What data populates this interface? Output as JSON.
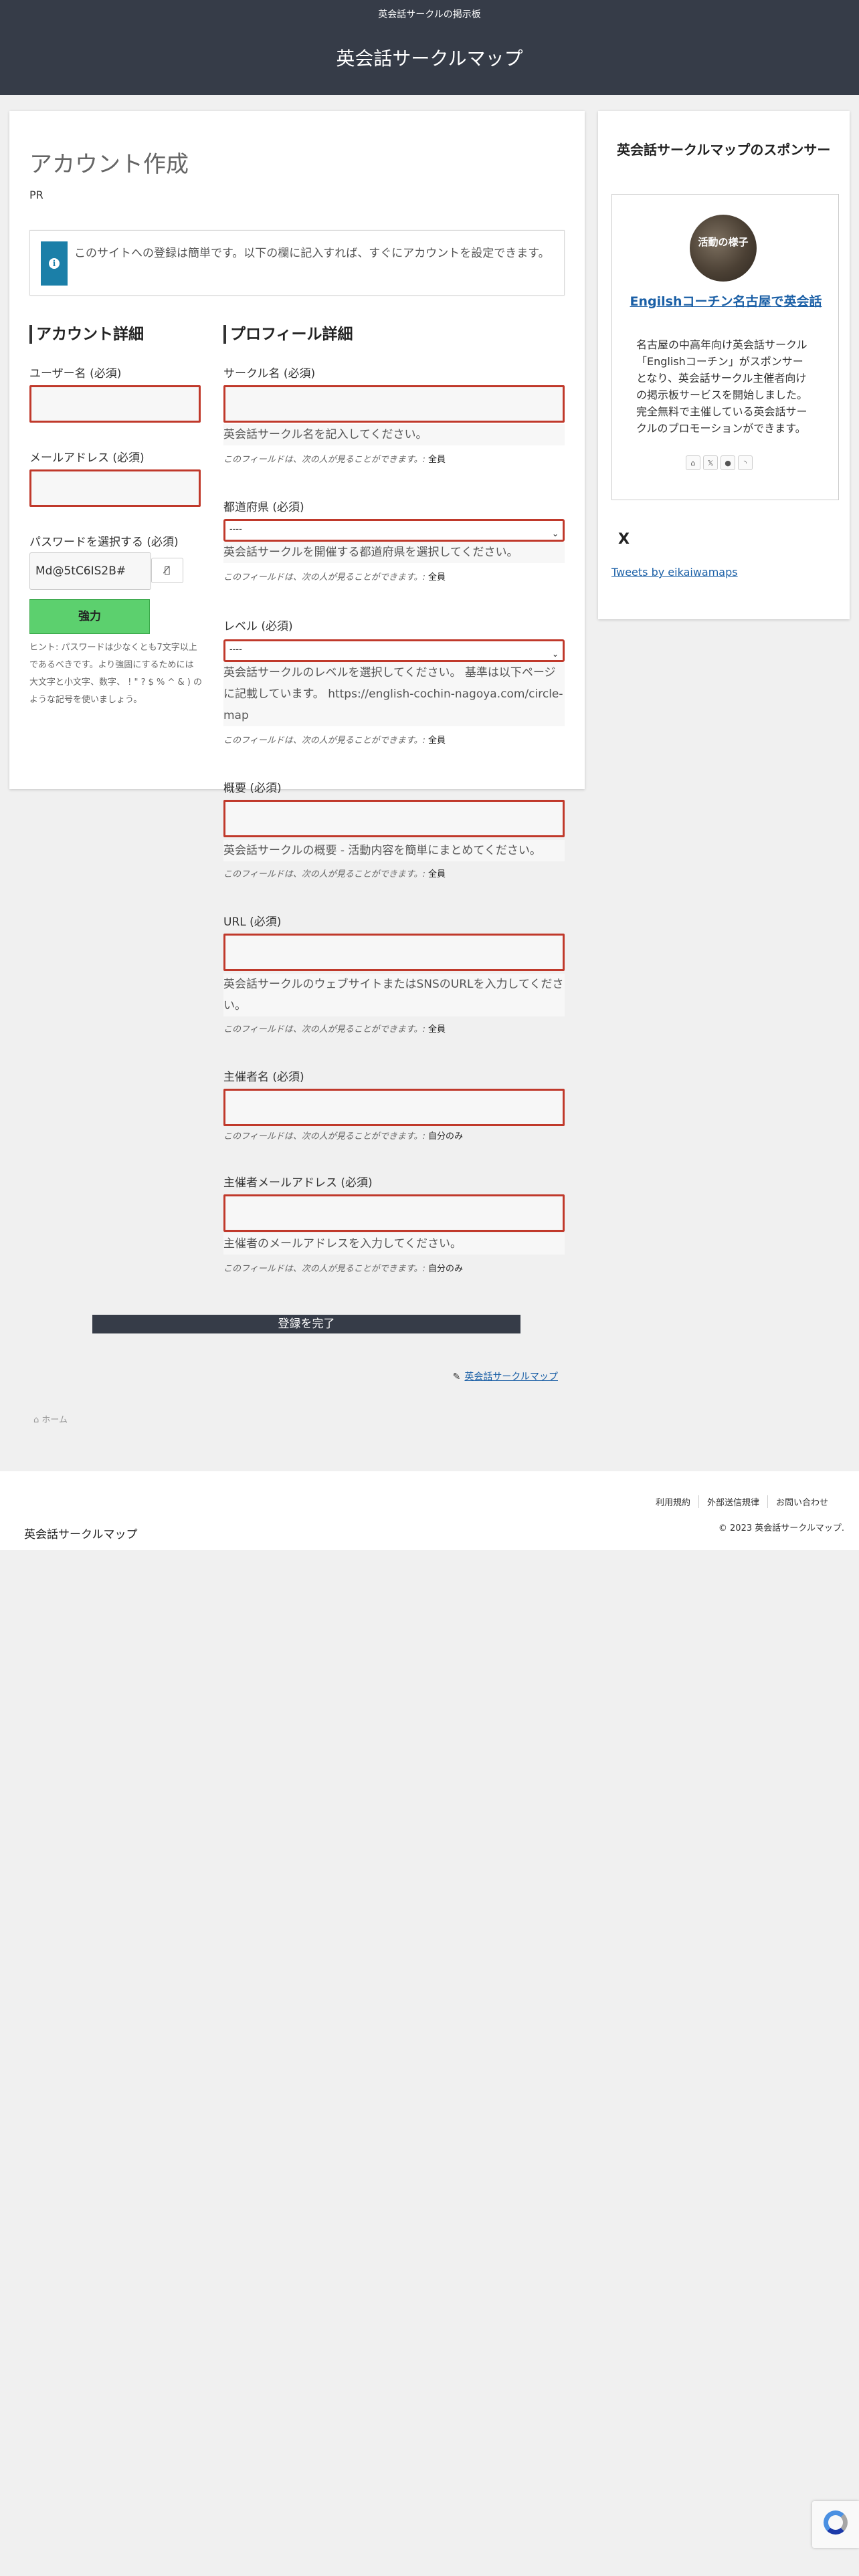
{
  "header": {
    "tagline": "英会話サークルの掲示板",
    "site_title": "英会話サークルマップ"
  },
  "main": {
    "page_title": "アカウント作成",
    "pr": "PR",
    "notice": "このサイトへの登録は簡単です。以下の欄に記入すれば、すぐにアカウントを設定できます。",
    "account": {
      "heading": "アカウント詳細",
      "username_label": "ユーザー名 (必須)",
      "email_label": "メールアドレス (必須)",
      "password_label": "パスワードを選択する (必須)",
      "password_value": "Md@5tC6IS2B#",
      "strength": "強力",
      "hint": "ヒント: パスワードは少なくとも7文字以上であるべきです。より強固にするためには大文字と小文字、数字、 ! \" ? $ % ^ & ) のような記号を使いましょう。"
    },
    "profile": {
      "heading": "プロフィール詳細",
      "visibility_prefix": "このフィールドは、次の人が見ることができます。:",
      "fields": [
        {
          "label": "サークル名 (必須)",
          "description": "英会話サークル名を記入してください。",
          "visibility": "全員"
        },
        {
          "label": "都道府県 (必須)",
          "select_value": "----",
          "description": "英会話サークルを開催する都道府県を選択してください。",
          "visibility": "全員"
        },
        {
          "label": "レベル (必須)",
          "select_value": "----",
          "description": "英会話サークルのレベルを選択してください。 基準は以下ページに記載しています。 https://english-cochin-nagoya.com/circle-map",
          "visibility": "全員"
        },
        {
          "label": "概要 (必須)",
          "description": "英会話サークルの概要 - 活動内容を簡単にまとめてください。",
          "visibility": "全員"
        },
        {
          "label": "URL (必須)",
          "description": "英会話サークルのウェブサイトまたはSNSのURLを入力してください。",
          "visibility": "全員"
        },
        {
          "label": "主催者名 (必須)",
          "visibility": "自分のみ"
        },
        {
          "label": "主催者メールアドレス (必須)",
          "description": "主催者のメールアドレスを入力してください。",
          "visibility": "自分のみ"
        }
      ]
    },
    "submit_label": "登録を完了",
    "edit_link": "英会話サークルマップ",
    "breadcrumb_home": "ホーム"
  },
  "sidebar": {
    "title": "英会話サークルマップのスポンサー",
    "sponsor": {
      "image_caption": "活動の様子",
      "name": "Engilshコーチン名古屋で英会話",
      "description": "名古屋の中高年向け英会話サークル「Englishコーチン」がスポンサーとなり、英会話サークル主催者向けの掲示板サービスを開始しました。完全無料で主催している英会話サークルのプロモーションができます。",
      "icons": [
        "home-icon",
        "x-icon",
        "blog-icon",
        "rss-icon"
      ]
    },
    "x_title": "X",
    "tweets_link": "Tweets by eikaiwamaps"
  },
  "footer": {
    "links": [
      "利用規約",
      "外部送信規律",
      "お問い合わせ"
    ],
    "copyright": "© 2023 英会話サークルマップ.",
    "site_name": "英会話サークルマップ"
  },
  "colors": {
    "header_bg": "#363c48",
    "error_border": "#c0392b",
    "link": "#1a5fa6",
    "strength_green": "#5cd06e",
    "info_blue": "#1b7fa8"
  }
}
